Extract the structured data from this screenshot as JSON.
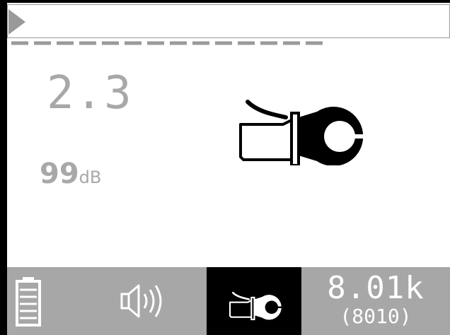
{
  "reading": {
    "value": "2.3"
  },
  "signal": {
    "value": "99",
    "unit": "dB"
  },
  "status_bar": {
    "frequency": "8.01k",
    "frequency_hz": "(8010)"
  },
  "icons": {
    "top": "play-icon",
    "main": "signal-clamp-icon",
    "battery": "battery-icon",
    "speaker": "speaker-icon",
    "mode": "signal-clamp-icon"
  },
  "colors": {
    "screen_bg": "#ffffff",
    "dim_text": "#a8a8a8",
    "status_bar_bg": "#a7a7a7",
    "selected_bg": "#000000"
  }
}
